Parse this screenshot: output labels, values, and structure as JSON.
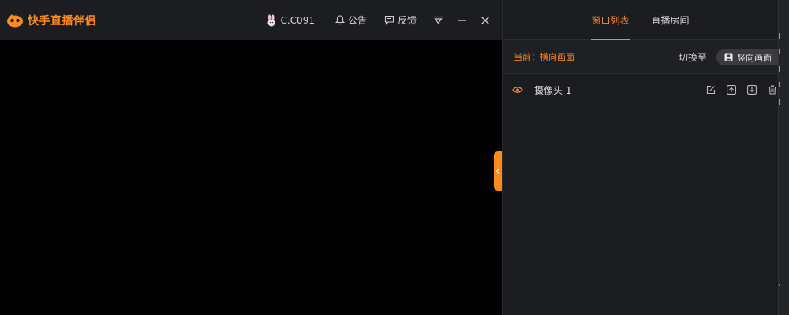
{
  "app": {
    "name": "快手直播伴侣",
    "brand_color": "#ff8a1a"
  },
  "titlebar": {
    "user_icon": "rabbit-avatar-icon",
    "username": "C.C091",
    "announcement_label": "公告",
    "feedback_label": "反馈",
    "buttons": [
      "dropdown-icon",
      "minimize-icon",
      "close-icon"
    ]
  },
  "panel": {
    "tabs": [
      {
        "label": "窗口列表",
        "active": true
      },
      {
        "label": "直播房间",
        "active": false
      }
    ],
    "mode": {
      "current_label": "当前：横向画面",
      "switch_to_label": "切换至",
      "switch_button_label": "竖向画面"
    },
    "sources": [
      {
        "name": "摄像头 1",
        "visible": true
      }
    ]
  }
}
